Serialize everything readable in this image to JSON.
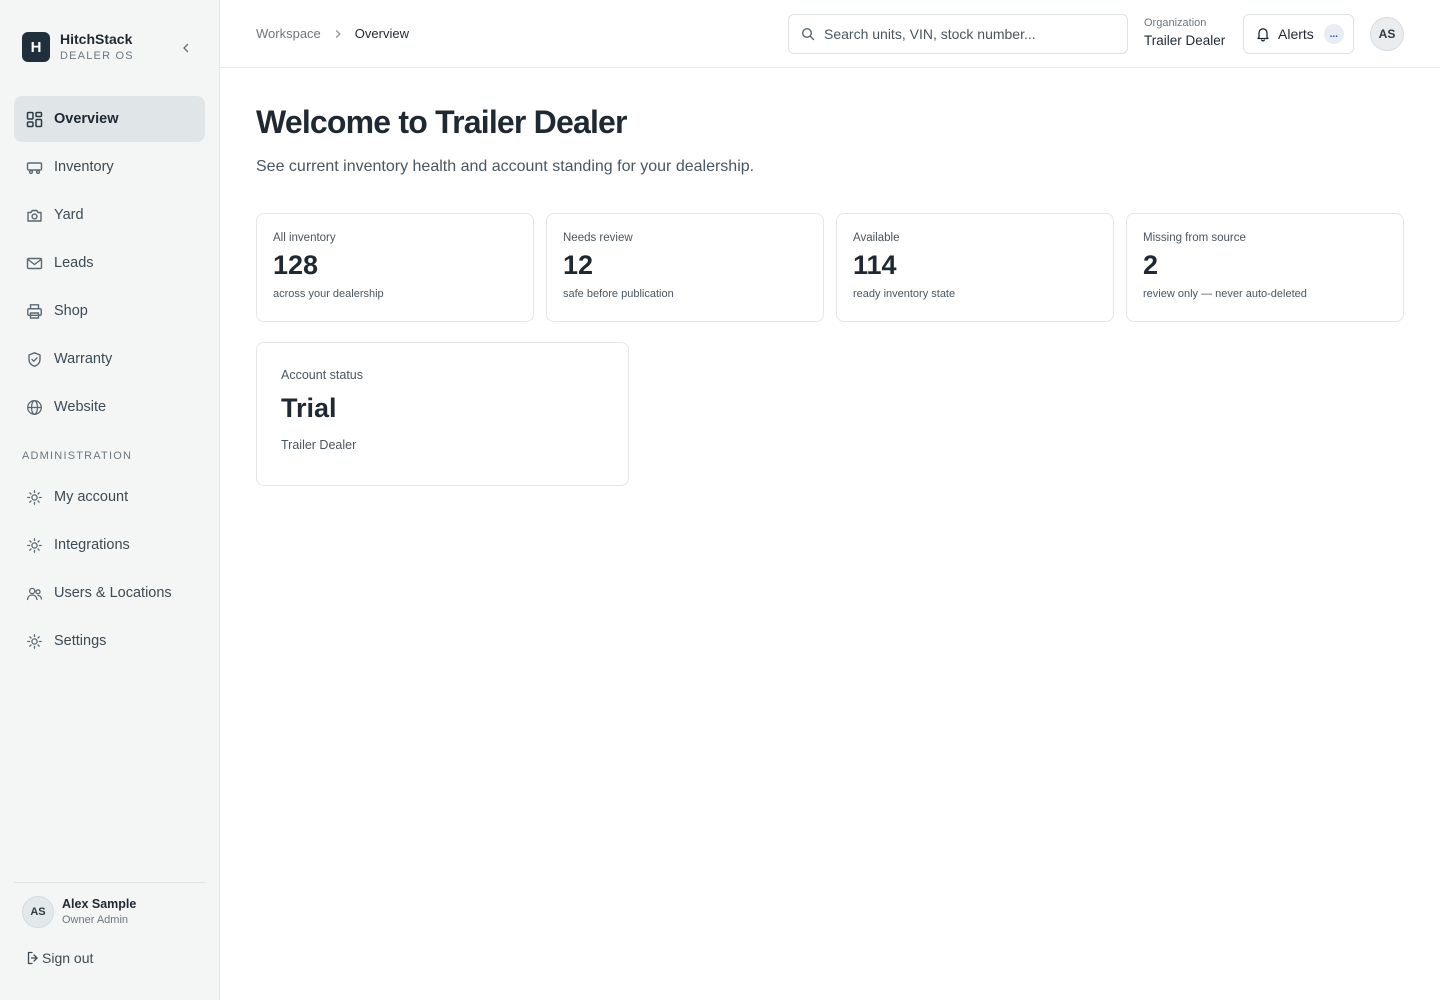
{
  "brand": {
    "mark": "H",
    "name": "HitchStack",
    "subtitle": "DEALER OS"
  },
  "sidebar": {
    "items": [
      {
        "label": "Overview",
        "icon": "grid-icon",
        "active": true
      },
      {
        "label": "Inventory",
        "icon": "trailer-icon"
      },
      {
        "label": "Yard",
        "icon": "camera-icon"
      },
      {
        "label": "Leads",
        "icon": "mail-icon"
      },
      {
        "label": "Shop",
        "icon": "printer-icon"
      },
      {
        "label": "Warranty",
        "icon": "shield-check-icon"
      },
      {
        "label": "Website",
        "icon": "globe-icon"
      }
    ],
    "admin_label": "ADMINISTRATION",
    "admin_items": [
      {
        "label": "My account",
        "icon": "gear-icon"
      },
      {
        "label": "Integrations",
        "icon": "gear-icon"
      },
      {
        "label": "Users & Locations",
        "icon": "users-icon"
      },
      {
        "label": "Settings",
        "icon": "gear-icon"
      }
    ],
    "user": {
      "initials": "AS",
      "name": "Alex Sample",
      "role": "Owner Admin"
    },
    "signout_label": "Sign out"
  },
  "topbar": {
    "breadcrumb": {
      "parent": "Workspace",
      "current": "Overview"
    },
    "search_placeholder": "Search units, VIN, stock number...",
    "org": {
      "label": "Organization",
      "name": "Trailer Dealer"
    },
    "alerts": {
      "label": "Alerts",
      "badge": "..."
    },
    "avatar_initials": "AS"
  },
  "main": {
    "title": "Welcome to Trailer Dealer",
    "subtitle": "See current inventory health and account standing for your dealership.",
    "stats": [
      {
        "label": "All inventory",
        "value": "128",
        "note": "across your dealership"
      },
      {
        "label": "Needs review",
        "value": "12",
        "note": "safe before publication"
      },
      {
        "label": "Available",
        "value": "114",
        "note": "ready inventory state"
      },
      {
        "label": "Missing from source",
        "value": "2",
        "note": "review only — never auto-deleted"
      }
    ],
    "account": {
      "label": "Account status",
      "value": "Trial",
      "note": "Trailer Dealer"
    }
  },
  "colors": {
    "brand_dark": "#1f2f3b",
    "sidebar_bg": "#f4f6f6",
    "active_bg": "#e0e6e7",
    "text_primary": "#1f2933",
    "text_muted": "#4a5660",
    "border": "#e3e7ea"
  }
}
